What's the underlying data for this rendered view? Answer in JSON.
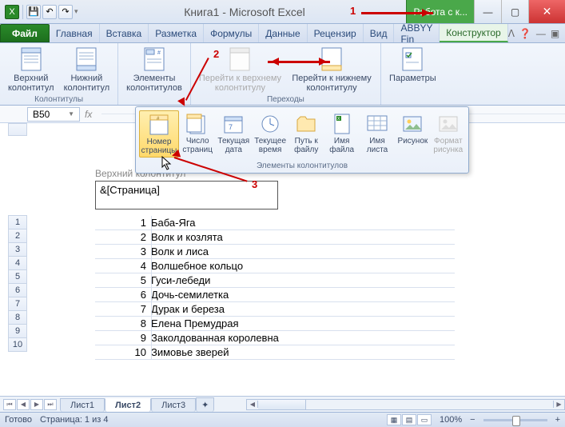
{
  "title": "Книга1 - Microsoft Excel",
  "contextual_tab_group": "Работа с к...",
  "window": {
    "min": "—",
    "max": "▢",
    "close": "✕"
  },
  "tabs": {
    "file": "Файл",
    "items": [
      "Главная",
      "Вставка",
      "Разметка",
      "Формулы",
      "Данные",
      "Рецензир",
      "Вид",
      "ABBYY Fin"
    ],
    "ctx": "Конструктор"
  },
  "help_row": {
    "up": "ᐱ",
    "help": "❓",
    "min": "—",
    "max": "▣",
    "close": "✕"
  },
  "ribbon": {
    "group1": {
      "label": "Колонтитулы",
      "btn1": "Верхний\nколонтитул",
      "btn2": "Нижний\nколонтитул"
    },
    "group2": {
      "label": "",
      "btn1": "Элементы\nколонтитулов"
    },
    "group3": {
      "label": "Переходы",
      "btn1": "Перейти к верхнему\nколонтитулу",
      "btn2": "Перейти к нижнему\nколонтитулу"
    },
    "group4": {
      "label": "",
      "btn1": "Параметры"
    }
  },
  "popup": {
    "label": "Элементы колонтитулов",
    "items": [
      {
        "id": "page-number",
        "label": "Номер\nстраницы",
        "selected": true
      },
      {
        "id": "page-count",
        "label": "Число\nстраниц"
      },
      {
        "id": "current-date",
        "label": "Текущая\nдата"
      },
      {
        "id": "current-time",
        "label": "Текущее\nвремя"
      },
      {
        "id": "file-path",
        "label": "Путь к\nфайлу"
      },
      {
        "id": "file-name",
        "label": "Имя\nфайла"
      },
      {
        "id": "sheet-name",
        "label": "Имя\nлиста"
      },
      {
        "id": "picture",
        "label": "Рисунок"
      },
      {
        "id": "picture-format",
        "label": "Формат\nрисунка",
        "disabled": true
      }
    ]
  },
  "namebox": "B50",
  "fx": "fx",
  "hf_label": "Верхний колонтитул",
  "hf_value": "&[Страница]",
  "rows": [
    {
      "n": 1,
      "v": "Баба-Яга"
    },
    {
      "n": 2,
      "v": "Волк и козлята"
    },
    {
      "n": 3,
      "v": "Волк и лиса"
    },
    {
      "n": 4,
      "v": "Волшебное кольцо"
    },
    {
      "n": 5,
      "v": "Гуси-лебеди"
    },
    {
      "n": 6,
      "v": "Дочь-семилетка"
    },
    {
      "n": 7,
      "v": "Дурак и береза"
    },
    {
      "n": 8,
      "v": "Елена Премудрая"
    },
    {
      "n": 9,
      "v": "Заколдованная королевна"
    },
    {
      "n": 10,
      "v": "Зимовье зверей"
    }
  ],
  "sheets": {
    "s1": "Лист1",
    "s2": "Лист2",
    "s3": "Лист3"
  },
  "status": {
    "ready": "Готово",
    "page": "Страница: 1 из 4",
    "zoom": "100%",
    "minus": "−",
    "plus": "+"
  },
  "annotations": {
    "a1": "1",
    "a2": "2",
    "a3": "3"
  },
  "qat": {
    "excel": "X",
    "save": "💾",
    "undo": "↶",
    "redo": "↷",
    "dd": "▾"
  }
}
